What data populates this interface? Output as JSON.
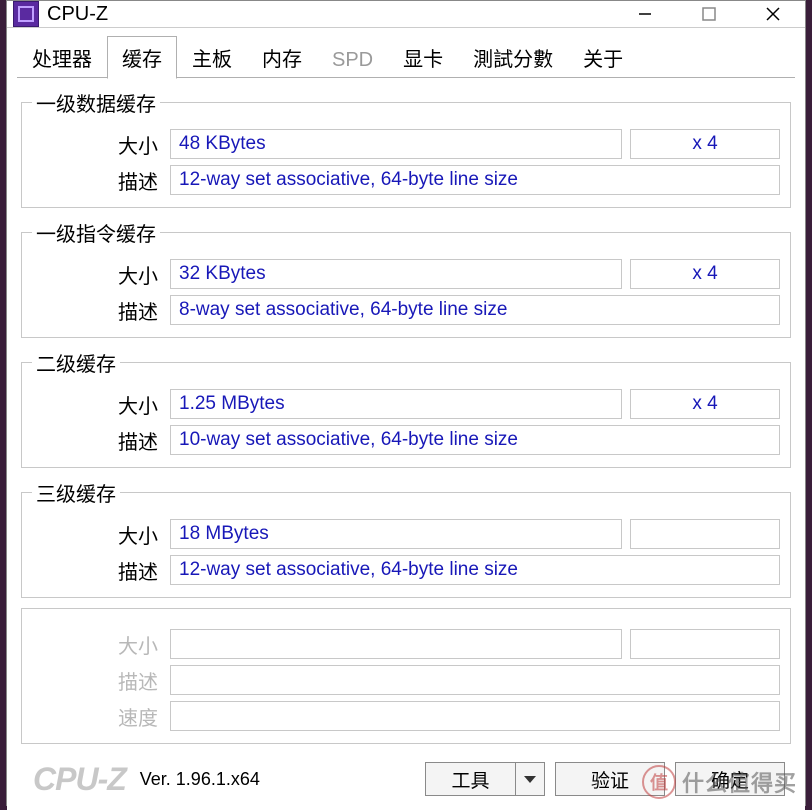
{
  "title": "CPU-Z",
  "tabs": [
    "处理器",
    "缓存",
    "主板",
    "内存",
    "SPD",
    "显卡",
    "測試分數",
    "关于"
  ],
  "active_tab_index": 1,
  "labels": {
    "size": "大小",
    "desc": "描述",
    "speed": "速度"
  },
  "groups": {
    "l1d": {
      "title": "一级数据缓存",
      "size": "48 KBytes",
      "mult": "x 4",
      "desc": "12-way set associative, 64-byte line size"
    },
    "l1i": {
      "title": "一级指令缓存",
      "size": "32 KBytes",
      "mult": "x 4",
      "desc": "8-way set associative, 64-byte line size"
    },
    "l2": {
      "title": "二级缓存",
      "size": "1.25 MBytes",
      "mult": "x 4",
      "desc": "10-way set associative, 64-byte line size"
    },
    "l3": {
      "title": "三级缓存",
      "size": "18 MBytes",
      "mult": "",
      "desc": "12-way set associative, 64-byte line size"
    },
    "l4": {
      "size": "",
      "desc": "",
      "speed": ""
    }
  },
  "footer": {
    "logo": "CPU-Z",
    "version": "Ver. 1.96.1.x64",
    "tools": "工具",
    "validate": "验证",
    "ok": "确定"
  },
  "watermark": {
    "badge": "值",
    "text": "什么值得买"
  }
}
